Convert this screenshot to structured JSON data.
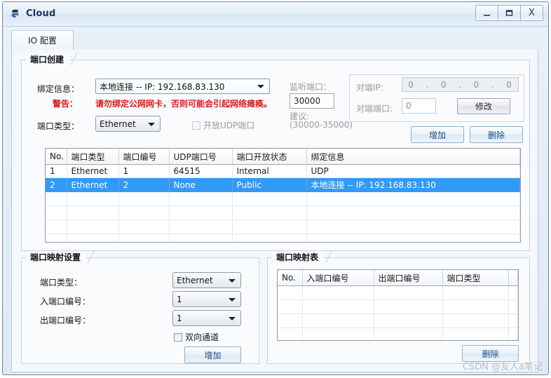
{
  "window": {
    "title": "Cloud",
    "icon": "cloud-logo-icon",
    "controls": {
      "minimize": "–",
      "maximize": "❒",
      "close": "X"
    }
  },
  "tabs": [
    {
      "label": "IO 配置",
      "active": true
    }
  ],
  "port_create": {
    "title": "端口创建",
    "binding_label": "绑定信息：",
    "binding_value": "本地连接 -- IP: 192.168.83.130",
    "warning_label": "警告：",
    "warning_text": "请勿绑定公网网卡，否则可能会引起网络瘫痪。",
    "port_type_label": "端口类型：",
    "port_type_value": "Ethernet",
    "udp_checkbox_label": "开放UDP端口",
    "listen_port_label": "监听端口：",
    "listen_port_value": "30000",
    "suggest_label": "建议:",
    "suggest_range": "(30000-35000)",
    "peer_ip_label": "对端IP:",
    "peer_ip_octets": [
      "0",
      "0",
      "0",
      "0"
    ],
    "peer_ip_sep": ".",
    "peer_port_label": "对端端口:",
    "peer_port_value": "0",
    "modify_button": "修改",
    "add_button": "增加",
    "delete_button": "删除"
  },
  "port_table": {
    "columns": [
      "No.",
      "端口类型",
      "端口编号",
      "UDP端口号",
      "端口开放状态",
      "绑定信息"
    ],
    "rows": [
      {
        "selected": false,
        "cells": [
          "1",
          "Ethernet",
          "1",
          "64515",
          "Internal",
          "UDP"
        ]
      },
      {
        "selected": true,
        "cells": [
          "2",
          "Ethernet",
          "2",
          "None",
          "Public",
          "本地连接 -- IP: 192.168.83.130"
        ]
      }
    ],
    "empty_row_count": 5
  },
  "mapping_settings": {
    "title": "端口映射设置",
    "port_type_label": "端口类型：",
    "port_type_value": "Ethernet",
    "in_port_label": "入端口编号：",
    "in_port_value": "1",
    "out_port_label": "出端口编号：",
    "out_port_value": "1",
    "bidirectional_label": "双向通道",
    "add_button": "增加"
  },
  "mapping_table": {
    "title": "端口映射表",
    "columns": [
      "No.",
      "入端口编号",
      "出端口编号",
      "端口类型",
      ""
    ],
    "rows": [],
    "empty_row_count": 5,
    "delete_button": "删除"
  },
  "watermark": "CSDN @友人a笔记",
  "colors": {
    "selection_blue": "#3399f6",
    "warning_red": "#e01b1b",
    "title_blue": "#15375e",
    "button_text_blue": "#1b4a86"
  }
}
